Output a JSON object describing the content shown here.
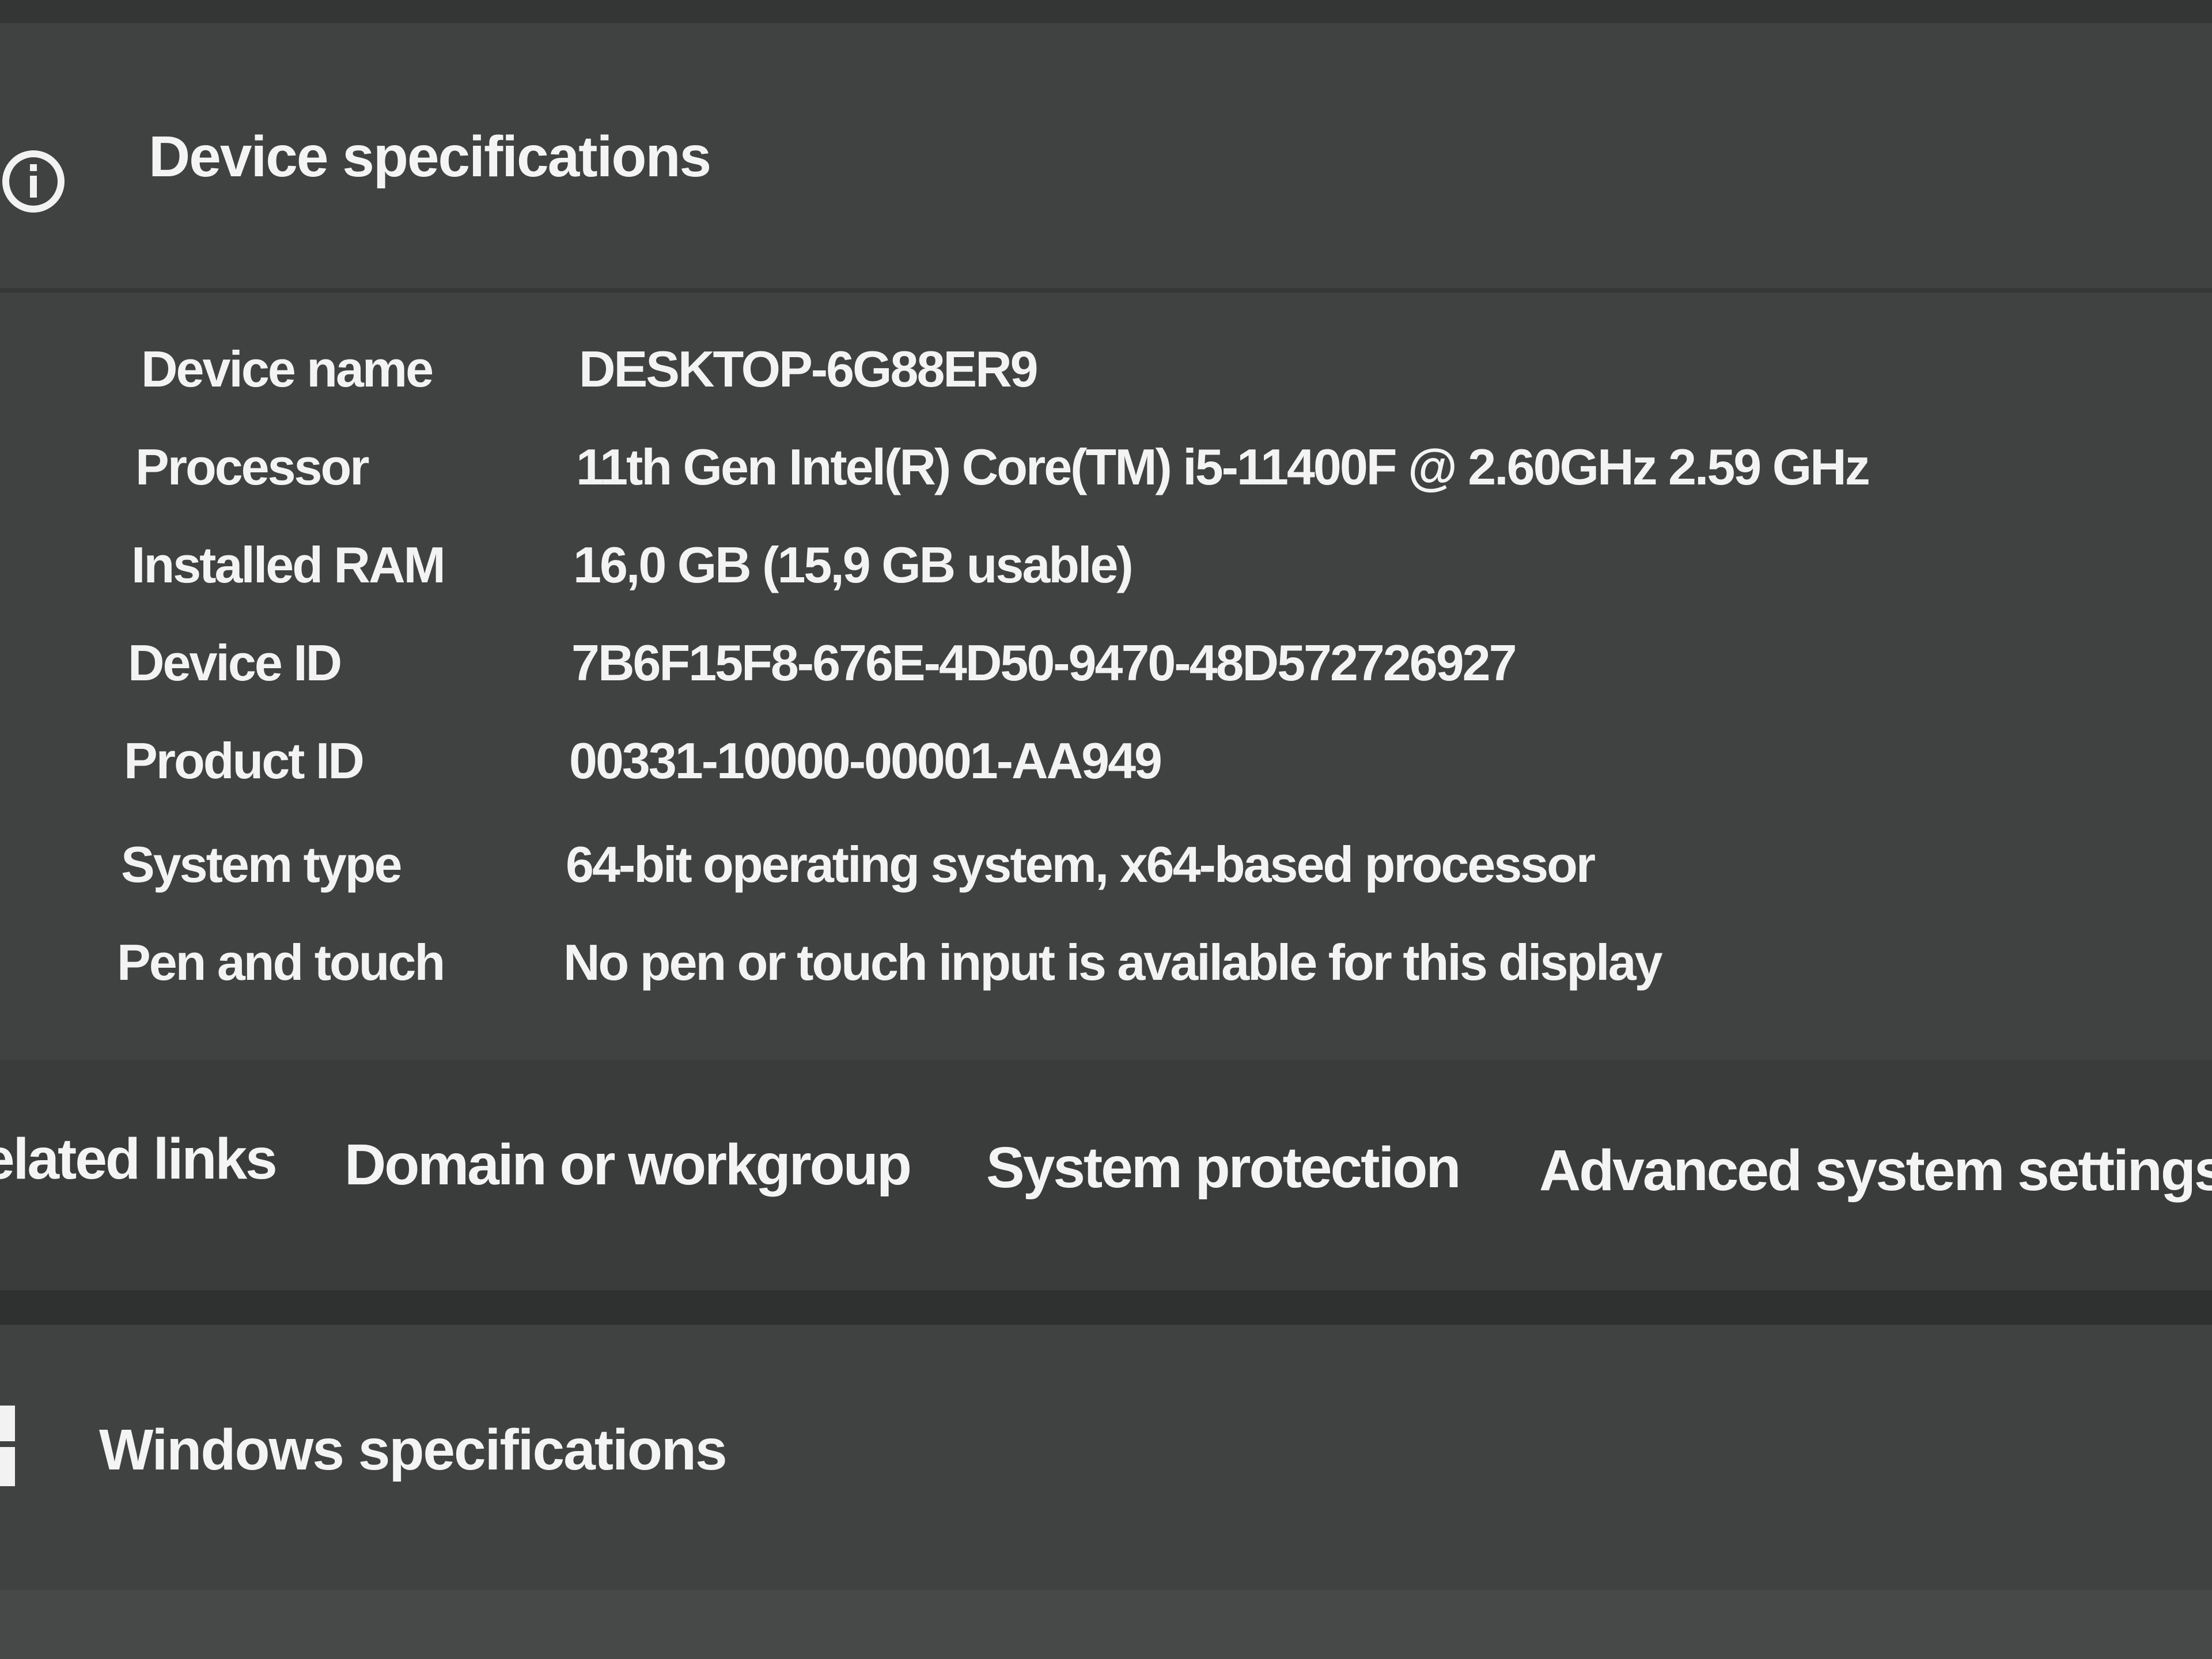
{
  "device_specs": {
    "title": "Device specifications",
    "icon": "info-icon",
    "rows": [
      {
        "label": "Device name",
        "value": "DESKTOP-6G88ER9"
      },
      {
        "label": "Processor",
        "value": "11th Gen Intel(R) Core(TM) i5-11400F @ 2.60GHz   2.59 GHz"
      },
      {
        "label": "Installed RAM",
        "value": "16,0 GB (15,9 GB usable)"
      },
      {
        "label": "Device ID",
        "value": "7B6F15F8-676E-4D50-9470-48D572726927"
      },
      {
        "label": "Product ID",
        "value": "00331-10000-00001-AA949"
      },
      {
        "label": "System type",
        "value": "64-bit operating system, x64-based processor"
      },
      {
        "label": "Pen and touch",
        "value": "No pen or touch input is available for this display"
      }
    ]
  },
  "related_links": {
    "heading": "elated links",
    "links": [
      "Domain or workgroup",
      "System protection",
      "Advanced system settings"
    ]
  },
  "windows_specs": {
    "title": "Windows specifications",
    "icon": "windows-icon"
  }
}
